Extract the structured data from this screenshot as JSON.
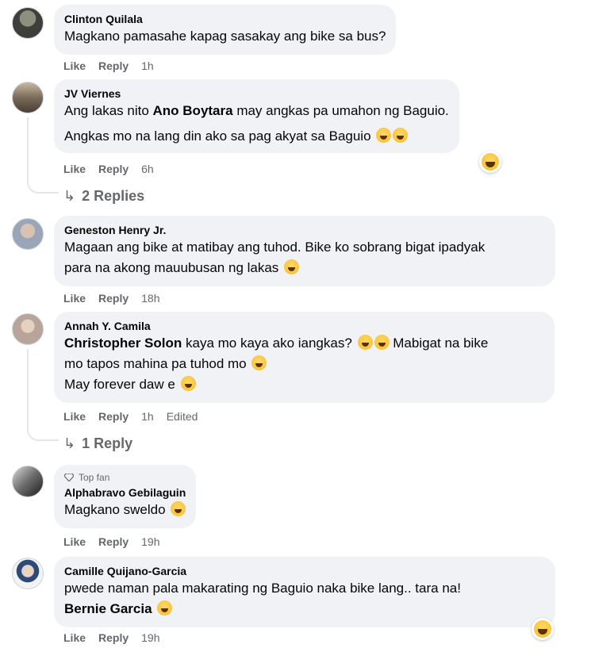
{
  "actions": {
    "like": "Like",
    "reply": "Reply"
  },
  "reaction_icon": "laughing-face-icon",
  "comments": [
    {
      "author": "Clinton Quilala",
      "lines": [
        "Magkano pamasahe kapag sasakay ang bike sa bus?"
      ],
      "time": "1h"
    },
    {
      "author": "JV Viernes",
      "mention": "Ano Boytara",
      "line1_before": "Ang lakas nito ",
      "line1_after": " may angkas pa umahon ng Baguio.",
      "line2": "Angkas mo na lang din ako sa pag akyat sa Baguio",
      "time": "6h",
      "replies": "2 Replies"
    },
    {
      "author": "Geneston Henry Jr.",
      "lines": [
        "Magaan ang bike at matibay ang tuhod. Bike ko sobrang bigat ipadyak",
        "para na akong mauubusan ng lakas"
      ],
      "time": "18h"
    },
    {
      "author": "Annah Y. Camila",
      "mention": "Christopher Solon",
      "line1_after": " kaya mo kaya ako iangkas?",
      "line1_tail": "Mabigat na bike",
      "line2": "mo tapos mahina pa tuhod mo",
      "line3": "May forever daw e",
      "time": "1h",
      "edited": "Edited",
      "replies": "1 Reply"
    },
    {
      "badge": "Top fan",
      "author": "Alphabravo Gebilaguin",
      "lines": [
        "Magkano sweldo"
      ],
      "time": "19h"
    },
    {
      "author": "Camille Quijano-Garcia",
      "line1": "pwede naman pala makarating ng Baguio naka bike lang.. tara na!",
      "mention": "Bernie Garcia",
      "time": "19h"
    }
  ]
}
